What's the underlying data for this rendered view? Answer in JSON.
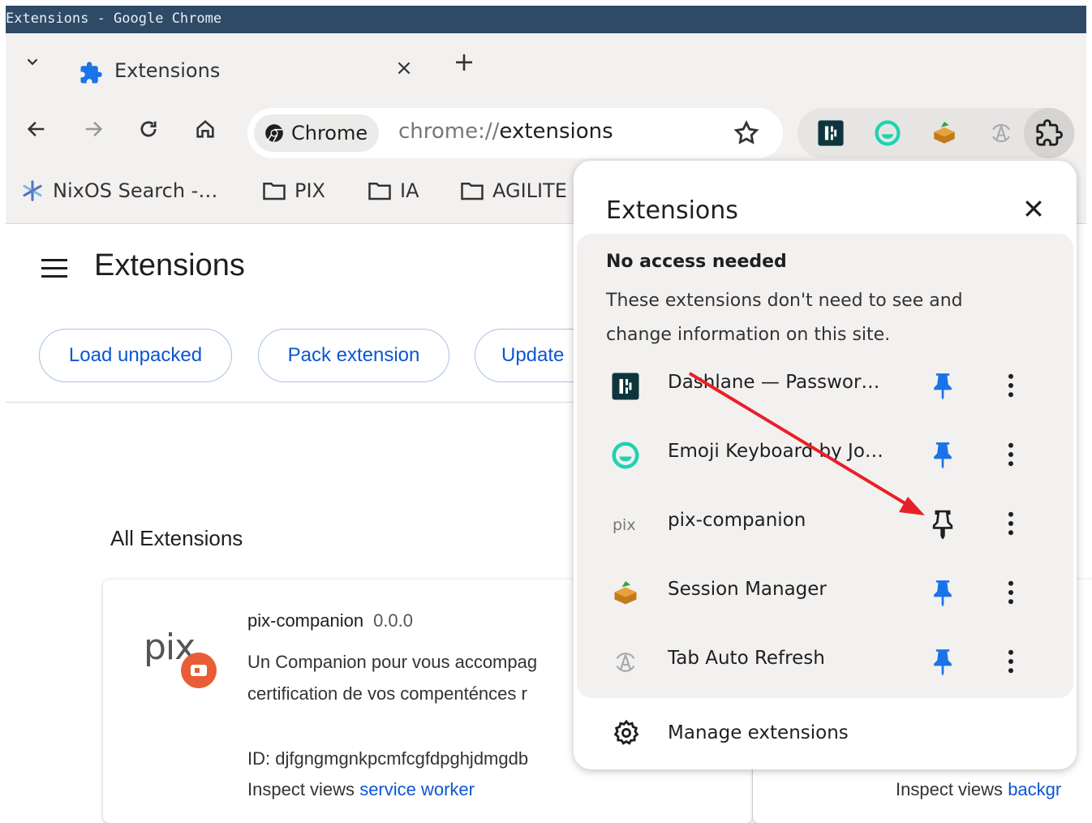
{
  "window": {
    "title": "Extensions - Google Chrome"
  },
  "tab": {
    "title": "Extensions",
    "close": "×",
    "new_tab": "+"
  },
  "omnibox": {
    "chip_label": "Chrome",
    "url_scheme": "chrome://",
    "url_host": "extensions"
  },
  "bookmarks": [
    {
      "label": "NixOS Search -…",
      "icon": "nixos-icon"
    },
    {
      "label": "PIX",
      "icon": "folder-icon"
    },
    {
      "label": "IA",
      "icon": "folder-icon"
    },
    {
      "label": "AGILITE",
      "icon": "folder-icon"
    }
  ],
  "page": {
    "title": "Extensions",
    "buttons": {
      "load_unpacked": "Load unpacked",
      "pack_extension": "Pack extension",
      "update": "Update"
    },
    "section_title": "All Extensions",
    "card": {
      "logo": "pix",
      "name": "pix-companion",
      "version": "0.0.0",
      "description": "Un Companion pour vous accompag certification de vos compenténces r",
      "id": "ID: djfgngmgnkpcmfcgfdpghjdmgdb",
      "inspect_prefix": "Inspect views",
      "inspect_link": "service worker"
    },
    "card2": {
      "inspect_prefix": "Inspect views",
      "inspect_link": "backgr"
    }
  },
  "popup": {
    "title": "Extensions",
    "section_heading": "No access needed",
    "section_text": "These extensions don't need to see and change information on this site.",
    "extensions": [
      {
        "name": "Dashlane — Passwor…",
        "pinned": true,
        "icon": "dashlane-icon"
      },
      {
        "name": "Emoji Keyboard by Jo…",
        "pinned": true,
        "icon": "emoji-keyboard-icon"
      },
      {
        "name": "pix-companion",
        "pinned": false,
        "icon": "pix-icon"
      },
      {
        "name": "Session Manager",
        "pinned": true,
        "icon": "session-manager-icon"
      },
      {
        "name": "Tab Auto Refresh",
        "pinned": true,
        "icon": "tab-auto-refresh-icon"
      }
    ],
    "manage_label": "Manage extensions"
  },
  "colors": {
    "titlebar": "#2e4a66",
    "accent": "#0b57d0",
    "pin": "#1a73e8",
    "annotation_arrow": "#e8202a",
    "pix_badge": "#e85d35"
  }
}
